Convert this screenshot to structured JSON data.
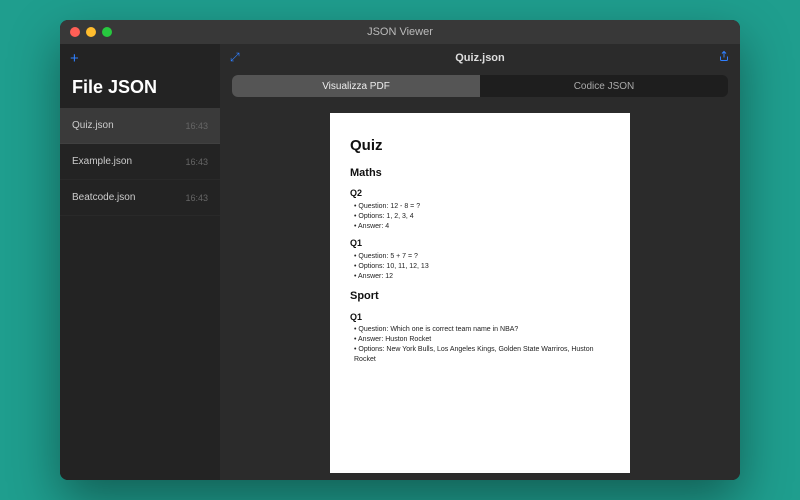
{
  "window": {
    "title": "JSON Viewer"
  },
  "sidebar": {
    "title": "File JSON",
    "add_icon": "+",
    "files": [
      {
        "name": "Quiz.json",
        "time": "16:43",
        "selected": true
      },
      {
        "name": "Example.json",
        "time": "16:43",
        "selected": false
      },
      {
        "name": "Beatcode.json",
        "time": "16:43",
        "selected": false
      }
    ]
  },
  "main": {
    "filename": "Quiz.json",
    "tabs": {
      "pdf": "Visualizza PDF",
      "code": "Codice JSON"
    },
    "document": {
      "title": "Quiz",
      "sections": [
        {
          "heading": "Maths",
          "questions": [
            {
              "label": "Q2",
              "lines": [
                "Question: 12 - 8 = ?",
                "Options: 1, 2, 3, 4",
                "Answer: 4"
              ]
            },
            {
              "label": "Q1",
              "lines": [
                "Question: 5 + 7 = ?",
                "Options: 10, 11, 12, 13",
                "Answer: 12"
              ]
            }
          ]
        },
        {
          "heading": "Sport",
          "questions": [
            {
              "label": "Q1",
              "lines": [
                "Question: Which one is correct team name in NBA?",
                "Answer: Huston Rocket",
                "Options: New York Bulls, Los Angeles Kings, Golden State Warriros, Huston Rocket"
              ]
            }
          ]
        }
      ]
    }
  }
}
